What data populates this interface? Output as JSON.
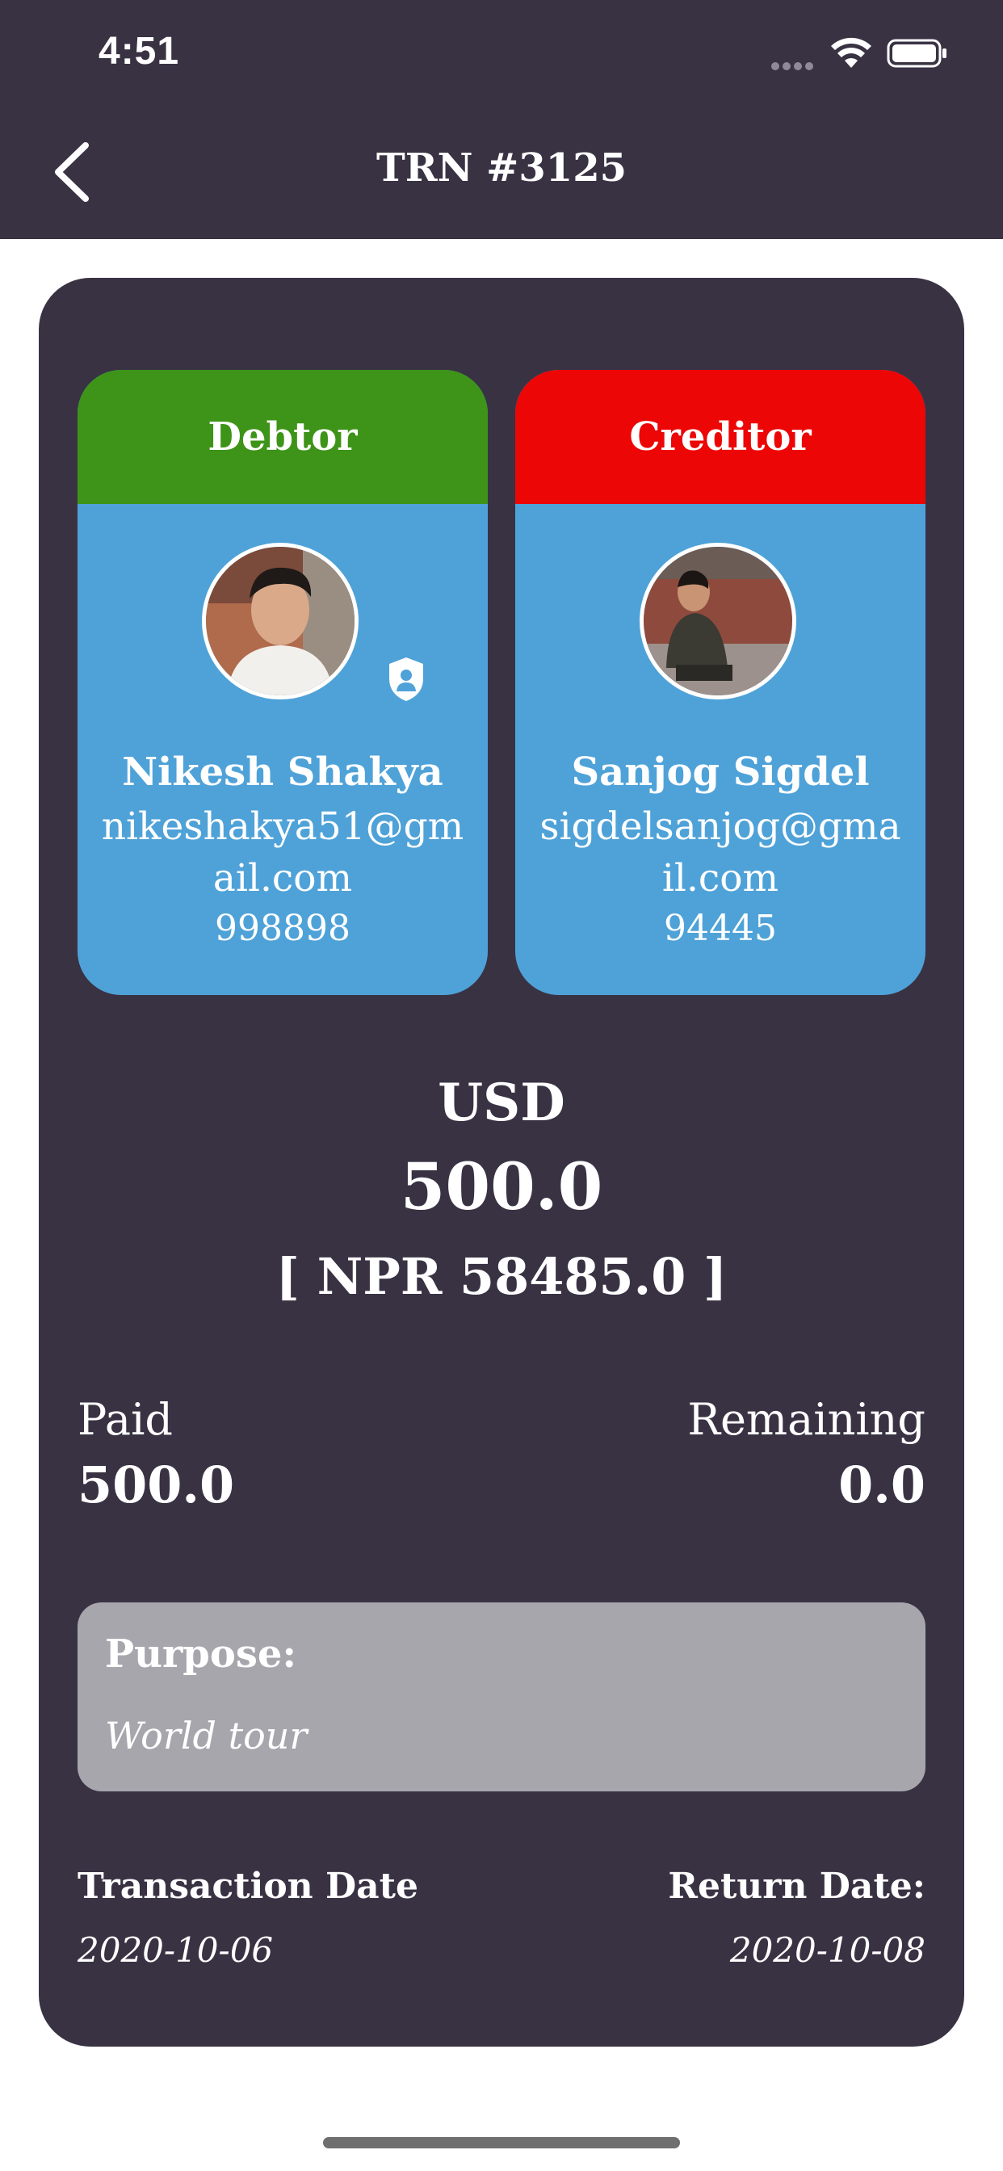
{
  "status_bar": {
    "time": "4:51"
  },
  "nav": {
    "title": "TRN #3125"
  },
  "debtor": {
    "role_label": "Debtor",
    "name": "Nikesh Shakya",
    "email": "nikeshakya51@gmail.com",
    "phone": "998898",
    "badge_icon": "user-shield-icon"
  },
  "creditor": {
    "role_label": "Creditor",
    "name": "Sanjog Sigdel",
    "email": "sigdelsanjog@gmail.com",
    "phone": "94445"
  },
  "amount": {
    "currency": "USD",
    "value": "500.0",
    "local": "[ NPR 58485.0 ]"
  },
  "balance": {
    "paid_label": "Paid",
    "paid_value": "500.0",
    "remaining_label": "Remaining",
    "remaining_value": "0.0"
  },
  "purpose": {
    "label": "Purpose:",
    "text": "World tour"
  },
  "dates": {
    "transaction_label": "Transaction Date",
    "transaction_value": "2020-10-06",
    "return_label": "Return Date:",
    "return_value": "2020-10-08"
  },
  "colors": {
    "header_bg": "#393243",
    "card_bg": "#393243",
    "party_bg": "#4fa2d8",
    "debtor_head": "#3e9418",
    "creditor_head": "#ec0606",
    "purpose_bg": "#a8a6ad"
  }
}
